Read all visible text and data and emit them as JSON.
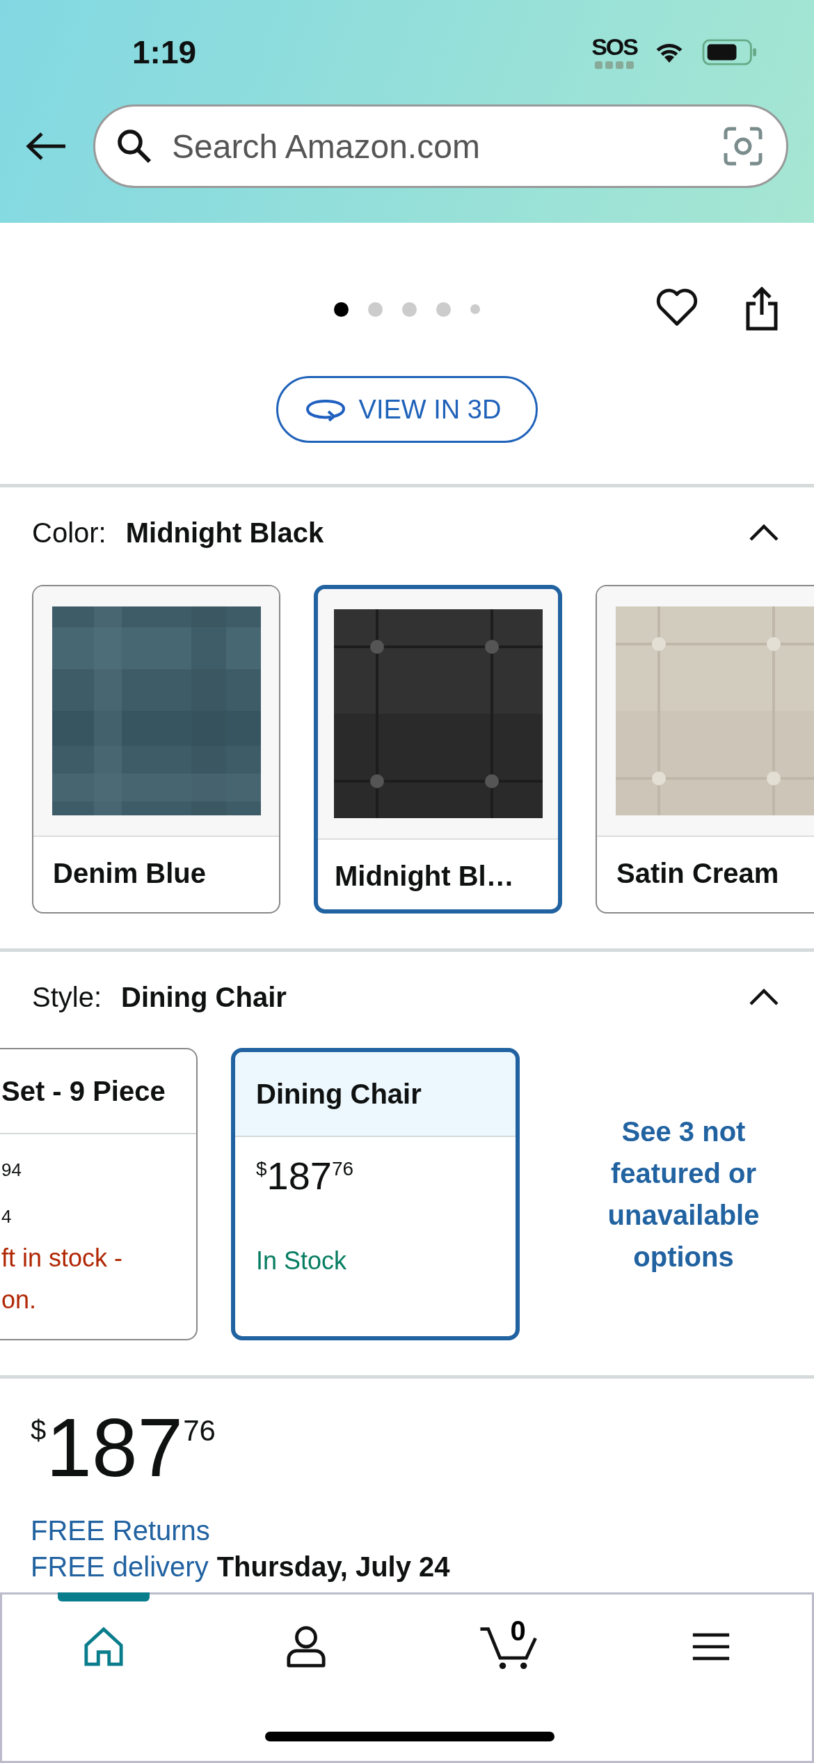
{
  "status_bar": {
    "time": "1:19",
    "sos": "SOS"
  },
  "search": {
    "placeholder": "Search Amazon.com"
  },
  "gallery": {
    "dots": [
      {
        "selected": true,
        "kind": "regular"
      },
      {
        "selected": false,
        "kind": "regular"
      },
      {
        "selected": false,
        "kind": "regular"
      },
      {
        "selected": false,
        "kind": "regular"
      },
      {
        "selected": false,
        "kind": "small"
      }
    ]
  },
  "view_3d": {
    "label": "VIEW IN 3D"
  },
  "color": {
    "label": "Color:",
    "value": "Midnight Black",
    "expanded": true,
    "options": [
      {
        "name": "Denim Blue",
        "selected": false
      },
      {
        "name": "Midnight Bl…",
        "selected": true
      },
      {
        "name": "Satin Cream",
        "selected": false
      }
    ]
  },
  "style": {
    "label": "Style:",
    "value": "Dining Chair",
    "expanded": true,
    "options": [
      {
        "name": "Set - 9 Piece",
        "selected": false,
        "lines": [
          {
            "kind": "price",
            "fraction": "94"
          },
          {
            "kind": "plain",
            "text": "4"
          },
          {
            "kind": "low_stock",
            "text": "ft in stock -"
          },
          {
            "kind": "low_stock",
            "text": "on."
          }
        ]
      },
      {
        "name": "Dining Chair",
        "selected": true,
        "lines": [
          {
            "kind": "price",
            "currency": "$",
            "whole": "187",
            "fraction": "76"
          },
          {
            "kind": "in_stock",
            "text": "In Stock"
          }
        ]
      }
    ],
    "more_link": "See 3 not featured or unavailable options"
  },
  "price": {
    "currency": "$",
    "whole": "187",
    "fraction": "76"
  },
  "returns": "FREE Returns",
  "delivery": {
    "label": "FREE delivery",
    "date": "Thursday, July 24"
  },
  "tab_bar": [
    {
      "kind": "home",
      "selected": true
    },
    {
      "kind": "account",
      "selected": false
    },
    {
      "kind": "cart",
      "selected": false,
      "count": "0"
    },
    {
      "kind": "menu",
      "selected": false
    }
  ]
}
